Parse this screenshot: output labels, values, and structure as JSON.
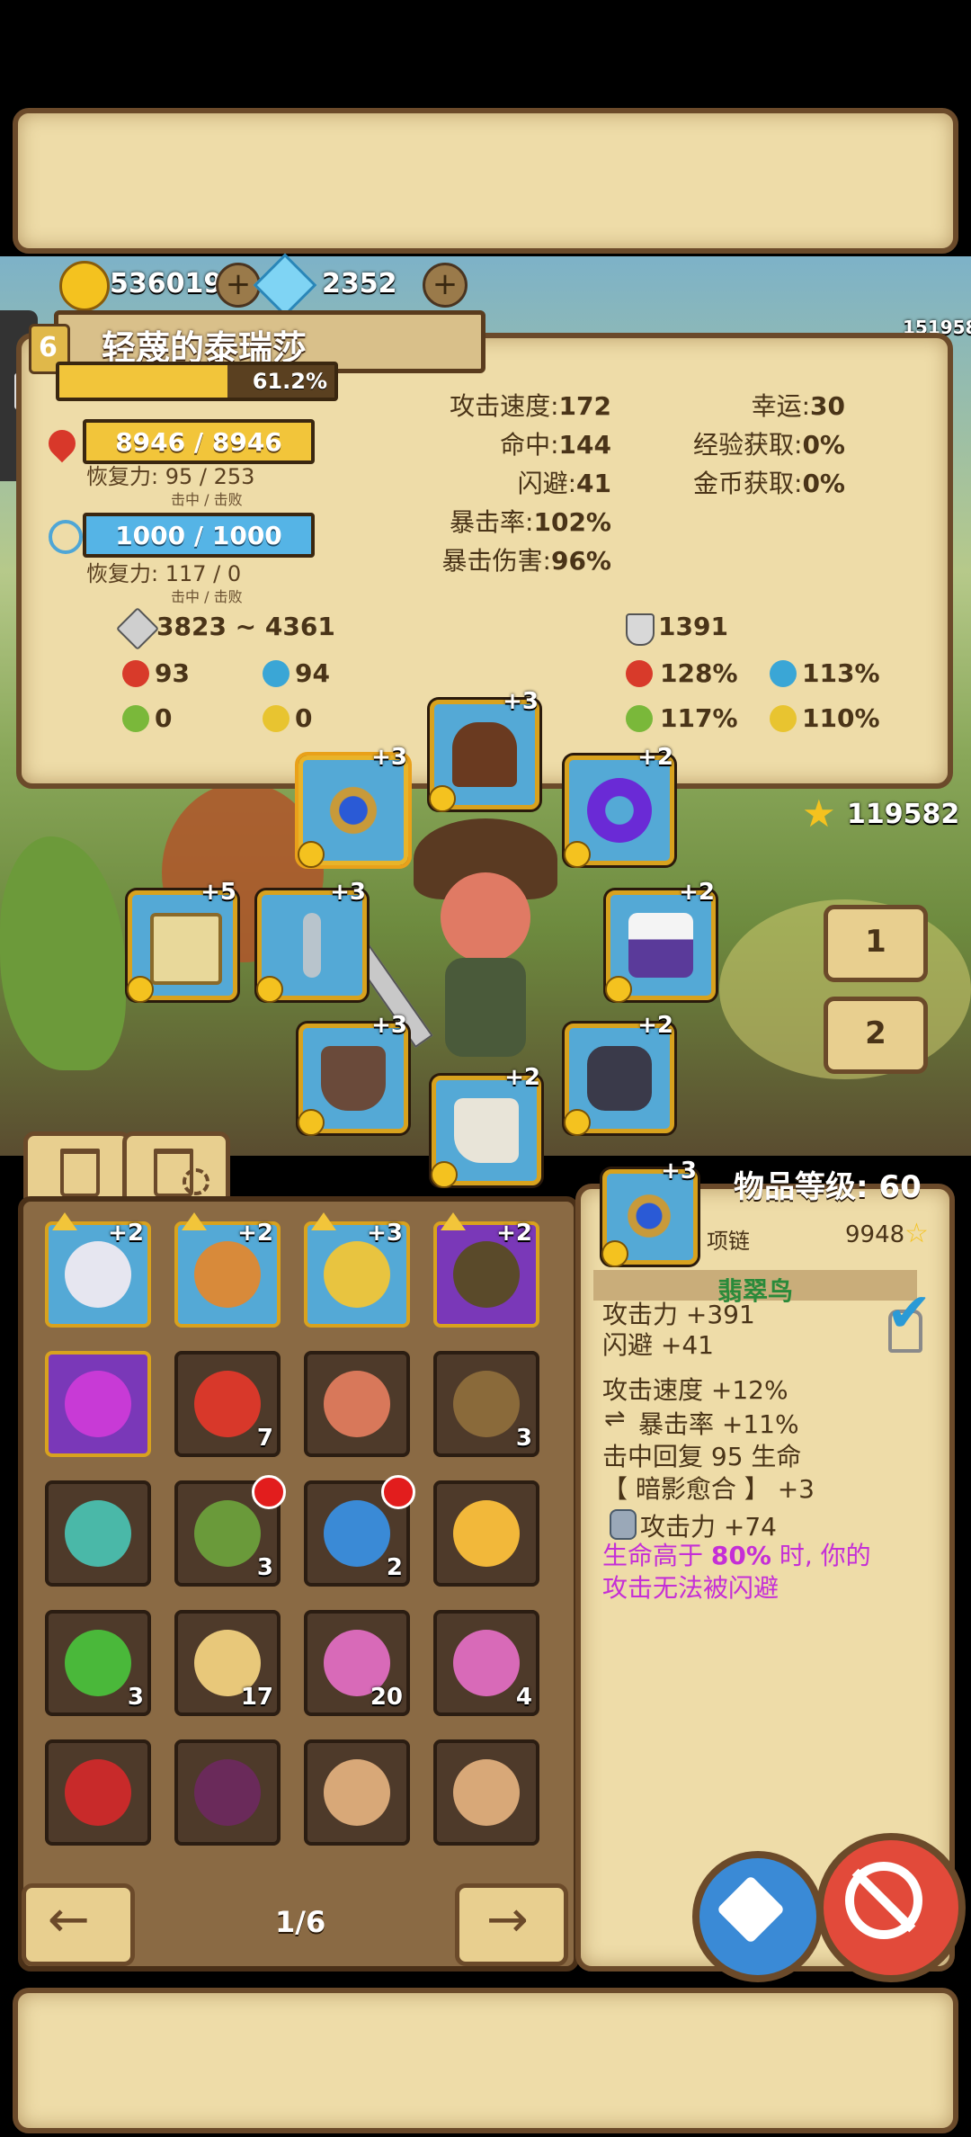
{
  "currency": {
    "gold": "536019",
    "diamonds": "2352",
    "player_id": "151958"
  },
  "character": {
    "name": "轻蔑的泰瑞莎",
    "level_partial": "6",
    "xp_percent": "61.2%",
    "xp_fraction": 0.612,
    "hp": "8946 / 8946",
    "hp_regen": "恢复力: 95 / 253",
    "hp_regen_sub": "击中 / 击败",
    "mp": "1000 / 1000",
    "mp_regen": "恢复力: 117 / 0",
    "mp_regen_sub": "击中 / 击败"
  },
  "stats_mid": [
    {
      "label": "攻击速度:",
      "value": "172"
    },
    {
      "label": "命中:",
      "value": "144"
    },
    {
      "label": "闪避:",
      "value": "41"
    },
    {
      "label": "暴击率:",
      "value": "102%"
    },
    {
      "label": "暴击伤害:",
      "value": "96%"
    }
  ],
  "stats_right": [
    {
      "label": "幸运:",
      "value": "30"
    },
    {
      "label": "经验获取:",
      "value": "0%"
    },
    {
      "label": "金币获取:",
      "value": "0%"
    }
  ],
  "combat": {
    "attack_range": "3823 ~ 4361",
    "defense": "1391",
    "fire_dmg": "93",
    "ice_dmg": "94",
    "poison_dmg": "0",
    "lightning_dmg": "0",
    "fire_res": "128%",
    "ice_res": "113%",
    "poison_res": "117%",
    "lightning_res": "110%"
  },
  "star_score": "119582",
  "page_buttons": [
    "1",
    "2"
  ],
  "equipment": [
    {
      "name": "necklace-slot",
      "plus": "+3"
    },
    {
      "name": "hat-slot",
      "plus": "+3"
    },
    {
      "name": "ring-slot",
      "plus": "+2"
    },
    {
      "name": "book-slot",
      "plus": "+5"
    },
    {
      "name": "sword-slot",
      "plus": "+3"
    },
    {
      "name": "armor-slot",
      "plus": "+2"
    },
    {
      "name": "pants-slot",
      "plus": "+3"
    },
    {
      "name": "boots-slot",
      "plus": "+2"
    },
    {
      "name": "gloves-slot",
      "plus": "+2"
    }
  ],
  "item_level": "物品等级: 60",
  "item_detail": {
    "plus": "+3",
    "type": "项链",
    "score": "9948",
    "name": "翡翠鸟",
    "attack": "攻击力 +391",
    "dodge": "闪避 +41",
    "attack_speed": "攻击速度 +12%",
    "crit_rate": "暴击率 +11%",
    "on_hit": "击中回复 95 生命",
    "set_bonus": "【 暗影愈合 】 +3",
    "gem_attack": "攻击力 +74",
    "special_prefix": "生命高于 ",
    "special_highlight": "80%",
    "special_suffix": " 时, 你的",
    "special_line2": "攻击无法被闪避"
  },
  "inventory": [
    {
      "name": "cape-item",
      "plus": "+2",
      "count": "",
      "style": "blue"
    },
    {
      "name": "boot-item",
      "plus": "+2",
      "count": "",
      "style": "blue"
    },
    {
      "name": "ring-item",
      "plus": "+3",
      "count": "",
      "style": "blue"
    },
    {
      "name": "vest-item",
      "plus": "+2",
      "count": "",
      "style": "purple"
    },
    {
      "name": "crystal-item",
      "plus": "",
      "count": "",
      "style": "purple"
    },
    {
      "name": "red-potion-item",
      "plus": "",
      "count": "7",
      "style": "plain"
    },
    {
      "name": "vial-item",
      "plus": "",
      "count": "",
      "style": "plain"
    },
    {
      "name": "stool-item",
      "plus": "",
      "count": "3",
      "style": "plain"
    },
    {
      "name": "green-flask-item",
      "plus": "",
      "count": "",
      "style": "plain"
    },
    {
      "name": "lantern-item",
      "plus": "",
      "count": "3",
      "style": "plain"
    },
    {
      "name": "blue-potion-item",
      "plus": "",
      "count": "2",
      "style": "plain"
    },
    {
      "name": "yellow-potion-item",
      "plus": "",
      "count": "",
      "style": "plain"
    },
    {
      "name": "green-potion-item",
      "plus": "",
      "count": "3",
      "style": "plain"
    },
    {
      "name": "gold-scroll-item",
      "plus": "",
      "count": "17",
      "style": "plain"
    },
    {
      "name": "pink-scroll-item",
      "plus": "",
      "count": "20",
      "style": "plain"
    },
    {
      "name": "pink-scroll-item-2",
      "plus": "",
      "count": "4",
      "style": "plain"
    },
    {
      "name": "red-cannon-item",
      "plus": "",
      "count": "",
      "style": "plain"
    },
    {
      "name": "purple-book-item",
      "plus": "",
      "count": "",
      "style": "plain"
    },
    {
      "name": "open-book-item",
      "plus": "",
      "count": "",
      "style": "plain"
    },
    {
      "name": "open-book-item-2",
      "plus": "",
      "count": "",
      "style": "plain"
    }
  ],
  "pager": "1/6",
  "colors": {
    "parchment": "#eedca8",
    "border": "#6b4a2a",
    "hp_bar": "#f2c53a",
    "mp_bar": "#55b4e6",
    "special_text": "#c52fd6"
  }
}
